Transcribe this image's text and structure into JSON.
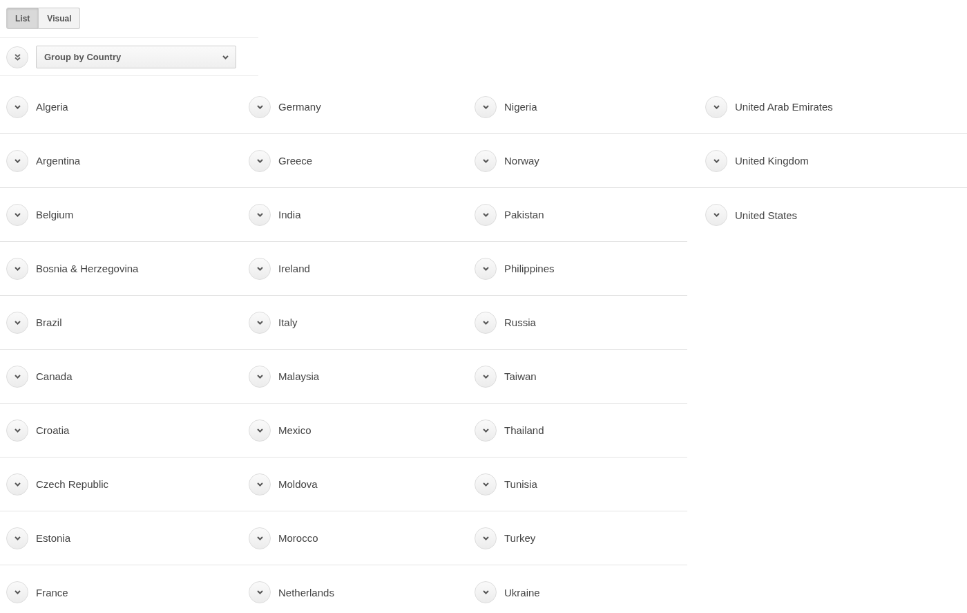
{
  "view_toggle": [
    {
      "label": "List",
      "selected": true
    },
    {
      "label": "Visual",
      "selected": false
    }
  ],
  "group_select": {
    "value": "Group by Country"
  },
  "columns": [
    {
      "groups": [
        {
          "name": "Algeria",
          "expanded": false
        },
        {
          "name": "Argentina",
          "expanded": false
        },
        {
          "name": "Belgium",
          "expanded": false
        },
        {
          "name": "Bosnia & Herzegovina",
          "expanded": false
        },
        {
          "name": "Brazil",
          "expanded": false
        },
        {
          "name": "Canada",
          "expanded": false
        },
        {
          "name": "Croatia",
          "expanded": false
        },
        {
          "name": "Czech Republic",
          "expanded": false
        },
        {
          "name": "Estonia",
          "expanded": false
        },
        {
          "name": "France",
          "expanded": false
        }
      ]
    },
    {
      "groups": [
        {
          "name": "Germany",
          "expanded": false
        },
        {
          "name": "Greece",
          "expanded": false
        },
        {
          "name": "India",
          "expanded": false
        },
        {
          "name": "Ireland",
          "expanded": false
        },
        {
          "name": "Italy",
          "expanded": false
        },
        {
          "name": "Malaysia",
          "expanded": false
        },
        {
          "name": "Mexico",
          "expanded": false
        },
        {
          "name": "Moldova",
          "expanded": false
        },
        {
          "name": "Morocco",
          "expanded": false
        },
        {
          "name": "Netherlands",
          "expanded": false
        }
      ]
    },
    {
      "groups": [
        {
          "name": "Nigeria",
          "expanded": false
        },
        {
          "name": "Norway",
          "expanded": false
        },
        {
          "name": "Pakistan",
          "expanded": false
        },
        {
          "name": "Philippines",
          "expanded": false
        },
        {
          "name": "Russia",
          "expanded": false
        },
        {
          "name": "Taiwan",
          "expanded": false
        },
        {
          "name": "Thailand",
          "expanded": false
        },
        {
          "name": "Tunisia",
          "expanded": false
        },
        {
          "name": "Turkey",
          "expanded": false
        },
        {
          "name": "Ukraine",
          "expanded": false
        }
      ]
    },
    {
      "groups": [
        {
          "name": "United Arab Emirates",
          "expanded": false
        },
        {
          "name": "United Kingdom",
          "expanded": false
        },
        {
          "name": "United States",
          "expanded": false
        }
      ]
    }
  ]
}
